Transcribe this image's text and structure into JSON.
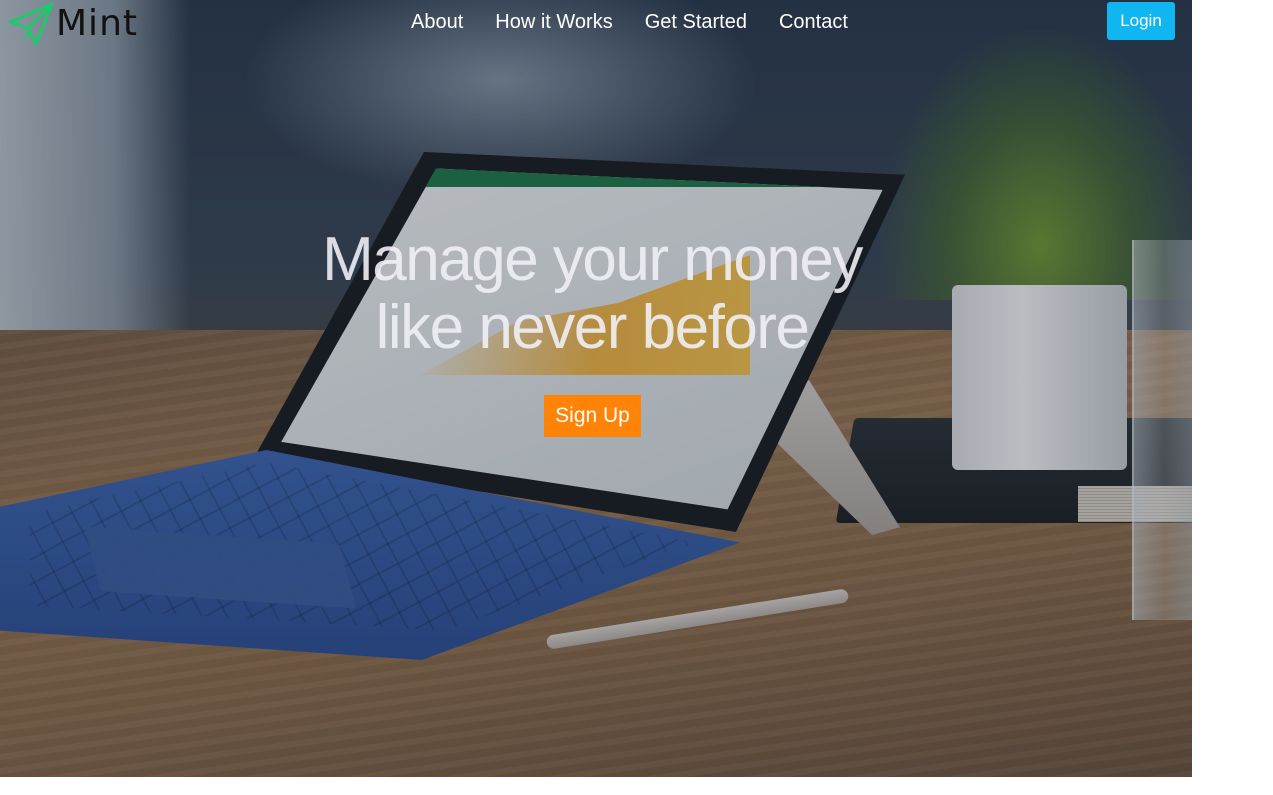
{
  "brand": {
    "name": "Mint",
    "logo_icon": "paper-plane-icon",
    "logo_color": "#1ec96b"
  },
  "nav": {
    "items": [
      {
        "label": "About"
      },
      {
        "label": "How it Works"
      },
      {
        "label": "Get Started"
      },
      {
        "label": "Contact"
      }
    ],
    "login_label": "Login",
    "login_color": "#10b6f0"
  },
  "hero": {
    "headline_line1": "Manage your money",
    "headline_line2": "like never before",
    "signup_label": "Sign Up",
    "signup_color": "#ff8306"
  }
}
